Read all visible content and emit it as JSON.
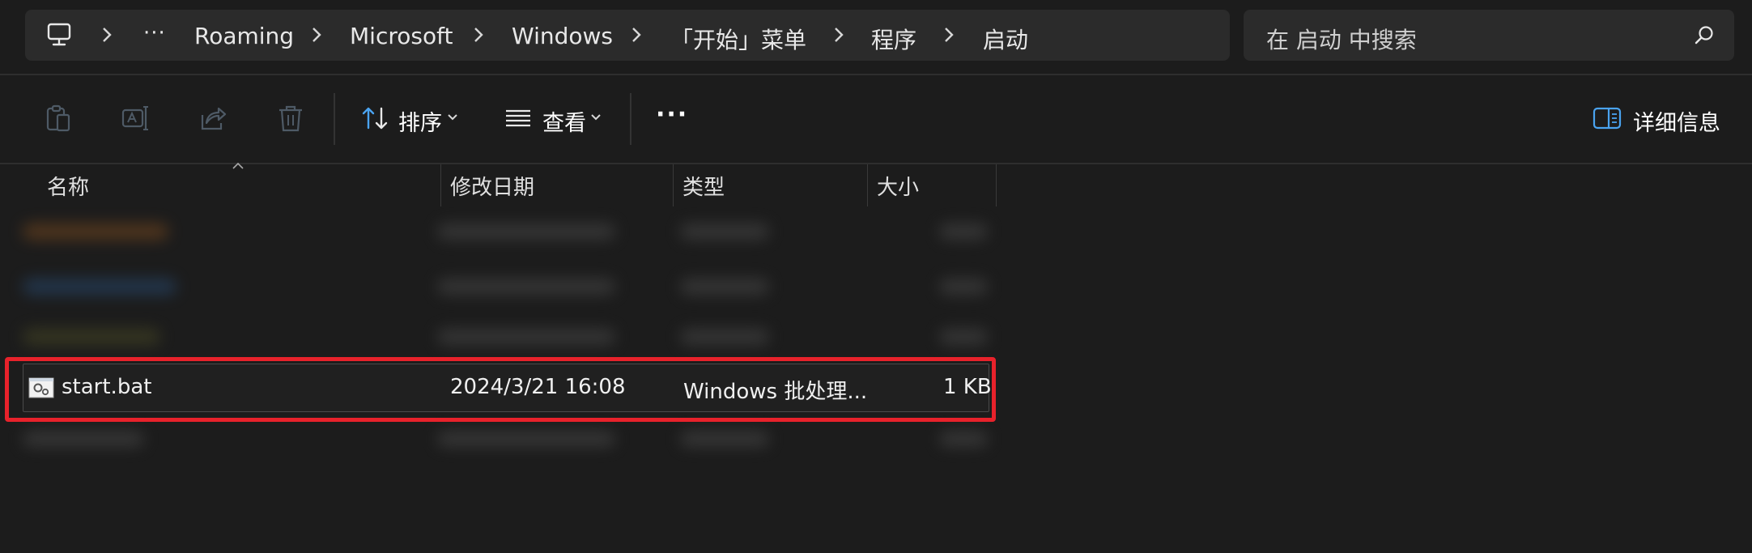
{
  "breadcrumb": {
    "overflow": "···",
    "items": [
      "Roaming",
      "Microsoft",
      "Windows",
      "「开始」菜单",
      "程序",
      "启动"
    ]
  },
  "search": {
    "placeholder": "在 启动 中搜索"
  },
  "toolbar": {
    "sort_label": "排序",
    "view_label": "查看",
    "more_label": "···",
    "details_label": "详细信息"
  },
  "columns": {
    "name": "名称",
    "modified": "修改日期",
    "type": "类型",
    "size": "大小"
  },
  "file": {
    "name": "start.bat",
    "modified": "2024/3/21 16:08",
    "type": "Windows 批处理...",
    "size": "1 KB"
  },
  "colors": {
    "background": "#1c1c1c",
    "highlight": "#e8222b",
    "accent_icon": "#4aa3f0"
  },
  "icons": [
    "pc-icon",
    "chevron-right-icon",
    "search-icon",
    "copy-icon",
    "rename-icon",
    "share-icon",
    "delete-icon",
    "sort-icon",
    "view-icon",
    "details-pane-icon",
    "bat-file-icon"
  ]
}
